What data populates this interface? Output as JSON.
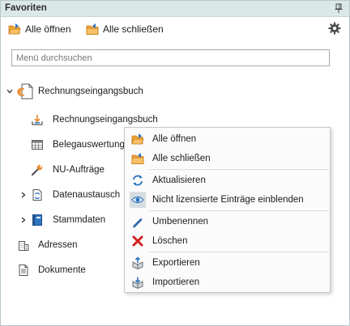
{
  "panel": {
    "title": "Favoriten",
    "pin_icon": "pin-icon"
  },
  "toolbar": {
    "open_all_label": "Alle öffnen",
    "close_all_label": "Alle schließen",
    "settings_icon": "gear-icon"
  },
  "search": {
    "placeholder": "Menü durchsuchen",
    "value": ""
  },
  "tree": {
    "root": {
      "label": "Rechnungseingangsbuch",
      "icon": "euro-document-icon",
      "expanded": true
    },
    "children": [
      {
        "label": "Rechnungseingangsbuch",
        "icon": "inbox-download-icon"
      },
      {
        "label": "Belegauswertung",
        "icon": "table-grid-icon"
      },
      {
        "label": "NU-Aufträge",
        "icon": "wrench-icon"
      },
      {
        "label": "Datenaustausch",
        "icon": "document-exchange-icon",
        "expanded": false
      },
      {
        "label": "Stammdaten",
        "icon": "book-icon",
        "expanded": false
      }
    ],
    "top_items": [
      {
        "label": "Adressen",
        "icon": "building-icon"
      },
      {
        "label": "Dokumente",
        "icon": "document-icon"
      }
    ]
  },
  "context_menu": {
    "items": [
      {
        "label": "Alle öffnen",
        "icon": "folder-open-icon"
      },
      {
        "label": "Alle schließen",
        "icon": "folder-close-icon"
      },
      {
        "label": "Aktualisieren",
        "icon": "refresh-icon"
      },
      {
        "label": "Nicht lizensierte Einträge einblenden",
        "icon": "eye-icon"
      },
      {
        "label": "Umbenennen",
        "icon": "pencil-icon"
      },
      {
        "label": "Löschen",
        "icon": "delete-x-icon"
      },
      {
        "label": "Exportieren",
        "icon": "box-export-icon"
      },
      {
        "label": "Importieren",
        "icon": "box-import-icon"
      }
    ]
  },
  "colors": {
    "titlebar_bg": "#dbe8e8",
    "accent_blue": "#2f74c0",
    "accent_orange": "#e8892b",
    "delete_red": "#d32020"
  }
}
